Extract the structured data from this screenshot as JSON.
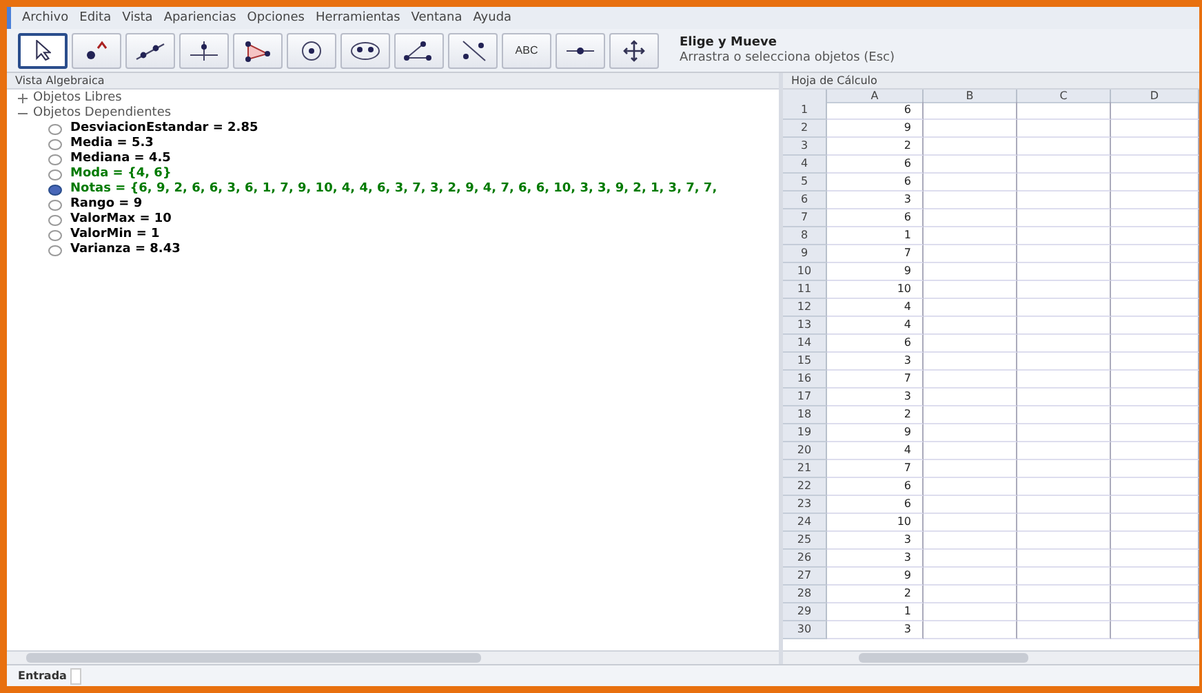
{
  "menu": [
    "Archivo",
    "Edita",
    "Vista",
    "Apariencias",
    "Opciones",
    "Herramientas",
    "Ventana",
    "Ayuda"
  ],
  "toolbar": {
    "tools": [
      {
        "kind": "pointer",
        "selected": true
      },
      {
        "kind": "point",
        "selected": false
      },
      {
        "kind": "line",
        "selected": false
      },
      {
        "kind": "perpendicular",
        "selected": false
      },
      {
        "kind": "polygon",
        "selected": false
      },
      {
        "kind": "circle",
        "selected": false
      },
      {
        "kind": "conic",
        "selected": false
      },
      {
        "kind": "angle",
        "selected": false
      },
      {
        "kind": "reflect",
        "selected": false
      },
      {
        "kind": "text",
        "label": "ABC",
        "selected": false
      },
      {
        "kind": "slider",
        "selected": false
      },
      {
        "kind": "move",
        "selected": false
      }
    ],
    "help_title": "Elige y Mueve",
    "help_text": "Arrastra o selecciona objetos (Esc)"
  },
  "algebra_view": {
    "title": "Vista Algebraica",
    "groups": [
      {
        "label": "Objetos Libres",
        "expanded": false
      },
      {
        "label": "Objetos Dependientes",
        "expanded": true,
        "items": [
          {
            "text": "DesviacionEstandar = 2.85",
            "visible": false,
            "color": "#000000"
          },
          {
            "text": "Media = 5.3",
            "visible": false,
            "color": "#000000"
          },
          {
            "text": "Mediana = 4.5",
            "visible": false,
            "color": "#000000"
          },
          {
            "text": "Moda = {4, 6}",
            "visible": false,
            "color": "#007a00"
          },
          {
            "text": "Notas = {6, 9, 2, 6, 6, 3, 6, 1, 7, 9, 10, 4, 4, 6, 3, 7, 3, 2, 9, 4, 7, 6, 6, 10, 3, 3, 9, 2, 1, 3, 7, 7,",
            "visible": true,
            "color": "#007a00"
          },
          {
            "text": "Rango = 9",
            "visible": false,
            "color": "#000000"
          },
          {
            "text": "ValorMax = 10",
            "visible": false,
            "color": "#000000"
          },
          {
            "text": "ValorMin = 1",
            "visible": false,
            "color": "#000000"
          },
          {
            "text": "Varianza = 8.43",
            "visible": false,
            "color": "#000000"
          }
        ]
      }
    ]
  },
  "spreadsheet": {
    "title": "Hoja de Cálculo",
    "columns": [
      "A",
      "B",
      "C",
      "D"
    ],
    "rows": [
      {
        "n": "1",
        "a": "6"
      },
      {
        "n": "2",
        "a": "9"
      },
      {
        "n": "3",
        "a": "2"
      },
      {
        "n": "4",
        "a": "6"
      },
      {
        "n": "5",
        "a": "6"
      },
      {
        "n": "6",
        "a": "3"
      },
      {
        "n": "7",
        "a": "6"
      },
      {
        "n": "8",
        "a": "1"
      },
      {
        "n": "9",
        "a": "7"
      },
      {
        "n": "10",
        "a": "9"
      },
      {
        "n": "11",
        "a": "10"
      },
      {
        "n": "12",
        "a": "4"
      },
      {
        "n": "13",
        "a": "4"
      },
      {
        "n": "14",
        "a": "6"
      },
      {
        "n": "15",
        "a": "3"
      },
      {
        "n": "16",
        "a": "7"
      },
      {
        "n": "17",
        "a": "3"
      },
      {
        "n": "18",
        "a": "2"
      },
      {
        "n": "19",
        "a": "9"
      },
      {
        "n": "20",
        "a": "4"
      },
      {
        "n": "21",
        "a": "7"
      },
      {
        "n": "22",
        "a": "6"
      },
      {
        "n": "23",
        "a": "6"
      },
      {
        "n": "24",
        "a": "10"
      },
      {
        "n": "25",
        "a": "3"
      },
      {
        "n": "26",
        "a": "3"
      },
      {
        "n": "27",
        "a": "9"
      },
      {
        "n": "28",
        "a": "2"
      },
      {
        "n": "29",
        "a": "1"
      },
      {
        "n": "30",
        "a": "3"
      }
    ]
  },
  "input_bar": {
    "label": "Entrada"
  }
}
